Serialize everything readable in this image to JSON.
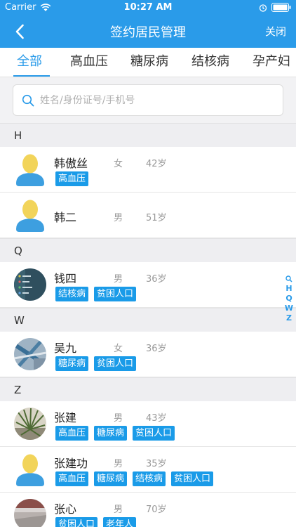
{
  "status_bar": {
    "carrier": "Carrier",
    "time": "10:27 AM"
  },
  "nav": {
    "title": "签约居民管理",
    "close_label": "关闭"
  },
  "tabs": [
    {
      "label": "全部",
      "active": true
    },
    {
      "label": "高血压"
    },
    {
      "label": "糖尿病"
    },
    {
      "label": "结核病"
    },
    {
      "label": "孕产妇"
    }
  ],
  "search": {
    "placeholder": "姓名/身份证号/手机号",
    "value": ""
  },
  "sections": [
    {
      "letter": "H",
      "rows": [
        {
          "name": "韩傲丝",
          "gender": "女",
          "age": "42岁",
          "avatar": "default-avatar",
          "tags": [
            "高血压"
          ]
        },
        {
          "name": "韩二",
          "gender": "男",
          "age": "51岁",
          "avatar": "default-avatar",
          "tags": []
        }
      ]
    },
    {
      "letter": "Q",
      "rows": [
        {
          "name": "钱四",
          "gender": "男",
          "age": "36岁",
          "avatar": "photo-avatar",
          "tags": [
            "结核病",
            "贫困人口"
          ]
        }
      ]
    },
    {
      "letter": "W",
      "rows": [
        {
          "name": "吴九",
          "gender": "女",
          "age": "36岁",
          "avatar": "photo-avatar",
          "tags": [
            "糖尿病",
            "贫困人口"
          ]
        }
      ]
    },
    {
      "letter": "Z",
      "rows": [
        {
          "name": "张建",
          "gender": "男",
          "age": "43岁",
          "avatar": "photo-avatar",
          "tags": [
            "高血压",
            "糖尿病",
            "贫困人口"
          ]
        },
        {
          "name": "张建功",
          "gender": "男",
          "age": "35岁",
          "avatar": "default-avatar",
          "tags": [
            "高血压",
            "糖尿病",
            "结核病",
            "贫困人口"
          ]
        },
        {
          "name": "张心",
          "gender": "男",
          "age": "70岁",
          "avatar": "photo-avatar",
          "tags": [
            "贫困人口",
            "老年人"
          ]
        }
      ]
    }
  ],
  "index_bar": [
    "H",
    "Q",
    "W",
    "Z"
  ],
  "colors": {
    "accent": "#2a9be9",
    "tag": "#1a9be8",
    "avatar_head": "#f2d45a",
    "avatar_body": "#3d9fe0"
  }
}
